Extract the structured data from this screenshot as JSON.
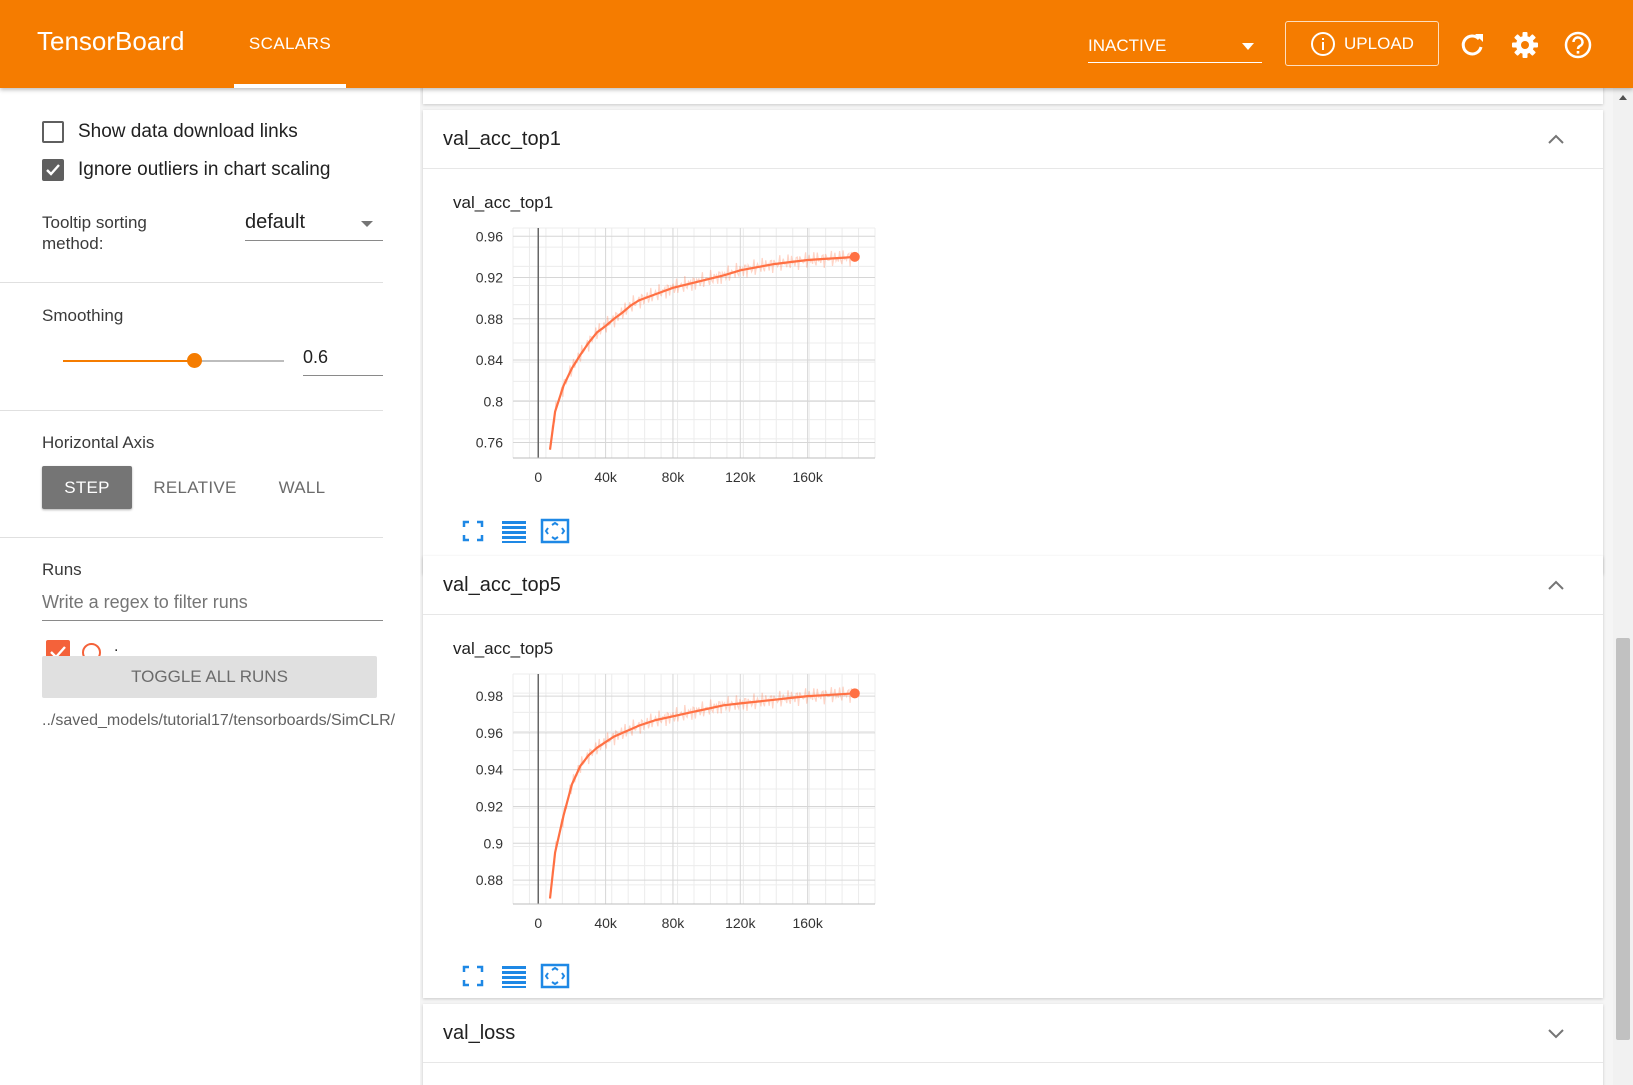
{
  "header": {
    "brand": "TensorBoard",
    "tab": "SCALARS",
    "status": "INACTIVE",
    "upload": "UPLOAD",
    "icons": [
      "info-icon",
      "refresh-icon",
      "settings-gear-icon",
      "help-icon"
    ],
    "color": "#f57c00"
  },
  "sidebar": {
    "show_download_links": "Show data download links",
    "ignore_outliers": "Ignore outliers in chart scaling",
    "tooltip_sorting_label": "Tooltip sorting method:",
    "tooltip_sorting_value": "default",
    "smoothing_label": "Smoothing",
    "smoothing_value": "0.6",
    "horizontal_axis_label": "Horizontal Axis",
    "axis_step": "STEP",
    "axis_relative": "RELATIVE",
    "axis_wall": "WALL",
    "runs_label": "Runs",
    "regex_placeholder": "Write a regex to filter runs",
    "run_name": ".",
    "toggle_all": "TOGGLE ALL RUNS",
    "logdir": "../saved_models/tutorial17/tensorboards/SimCLR/"
  },
  "main": {
    "partial_top_text": "",
    "cards": [
      {
        "title": "val_acc_top1",
        "chart_title": "val_acc_top1"
      },
      {
        "title": "val_acc_top5",
        "chart_title": "val_acc_top5"
      },
      {
        "title": "val_loss"
      }
    ]
  },
  "chart_data": [
    {
      "type": "line",
      "title": "val_acc_top1",
      "xlabel": "",
      "ylabel": "",
      "xlim": [
        -15000,
        200000
      ],
      "ylim": [
        0.745,
        0.968
      ],
      "x_ticks": [
        "0",
        "40k",
        "80k",
        "120k",
        "160k"
      ],
      "y_ticks": [
        "0.96",
        "0.92",
        "0.88",
        "0.84",
        "0.8",
        "0.76"
      ],
      "grid": true,
      "series": [
        {
          "color": "#ff7043",
          "x": [
            7000,
            10000,
            15000,
            20000,
            25000,
            30000,
            35000,
            40000,
            45000,
            50000,
            55000,
            60000,
            70000,
            80000,
            90000,
            100000,
            110000,
            120000,
            130000,
            140000,
            150000,
            160000,
            170000,
            180000,
            188000
          ],
          "y": [
            0.753,
            0.79,
            0.815,
            0.832,
            0.845,
            0.857,
            0.867,
            0.873,
            0.88,
            0.886,
            0.893,
            0.898,
            0.904,
            0.91,
            0.914,
            0.918,
            0.922,
            0.927,
            0.93,
            0.933,
            0.935,
            0.937,
            0.938,
            0.939,
            0.94
          ]
        }
      ]
    },
    {
      "type": "line",
      "title": "val_acc_top5",
      "xlabel": "",
      "ylabel": "",
      "xlim": [
        -15000,
        200000
      ],
      "ylim": [
        0.867,
        0.992
      ],
      "x_ticks": [
        "0",
        "40k",
        "80k",
        "120k",
        "160k"
      ],
      "y_ticks": [
        "0.98",
        "0.96",
        "0.94",
        "0.92",
        "0.9",
        "0.88"
      ],
      "grid": true,
      "series": [
        {
          "color": "#ff7043",
          "x": [
            7000,
            10000,
            15000,
            20000,
            25000,
            30000,
            35000,
            40000,
            45000,
            50000,
            55000,
            60000,
            70000,
            80000,
            90000,
            100000,
            110000,
            120000,
            130000,
            140000,
            150000,
            160000,
            170000,
            180000,
            188000
          ],
          "y": [
            0.87,
            0.895,
            0.915,
            0.932,
            0.942,
            0.948,
            0.952,
            0.955,
            0.958,
            0.96,
            0.962,
            0.964,
            0.967,
            0.969,
            0.971,
            0.973,
            0.975,
            0.976,
            0.977,
            0.978,
            0.979,
            0.98,
            0.9805,
            0.981,
            0.9815
          ]
        }
      ]
    }
  ]
}
